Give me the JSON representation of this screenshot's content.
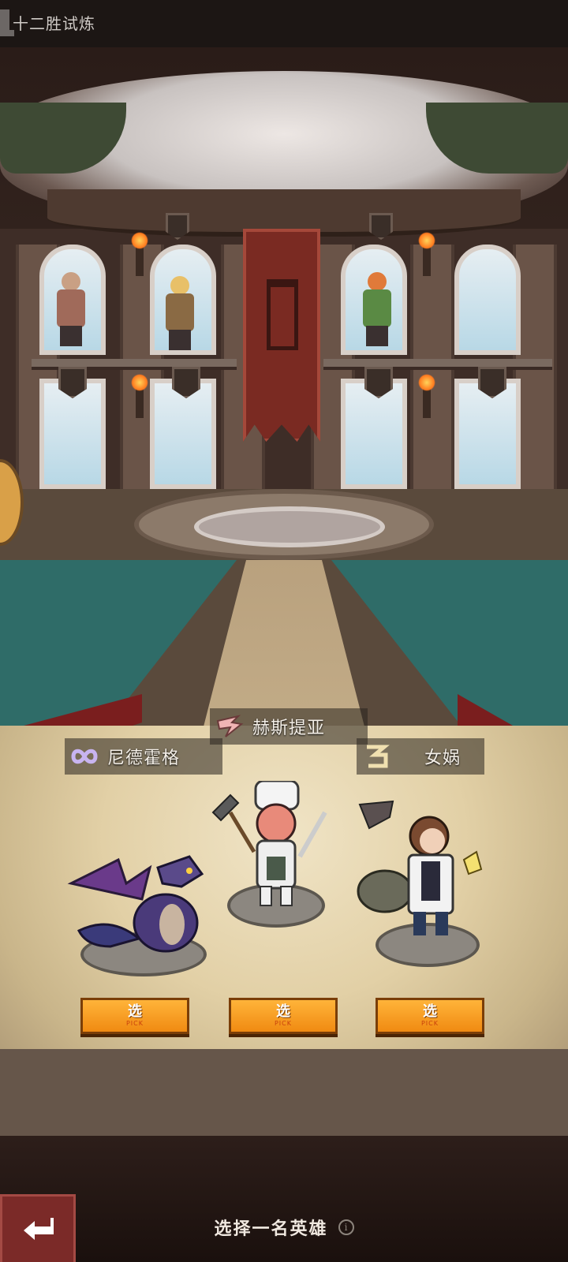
{
  "header": {
    "title": "十二胜试炼"
  },
  "heroes": [
    {
      "name": "尼德霍格",
      "pick_label": "选",
      "pick_sub": "PICK",
      "emblem": "infinity-icon",
      "color": "#c8b4f0"
    },
    {
      "name": "赫斯提亚",
      "pick_label": "选",
      "pick_sub": "PICK",
      "emblem": "flame-sigil-icon",
      "color": "#f0b4b4"
    },
    {
      "name": "女娲",
      "pick_label": "选",
      "pick_sub": "PICK",
      "emblem": "serpent-sigil-icon",
      "color": "#f0e0b0"
    }
  ],
  "footer": {
    "prompt": "选择一名英雄",
    "info_glyph": "i"
  },
  "colors": {
    "pick_button": "#f59a1e",
    "back_button": "#7b2a28"
  }
}
